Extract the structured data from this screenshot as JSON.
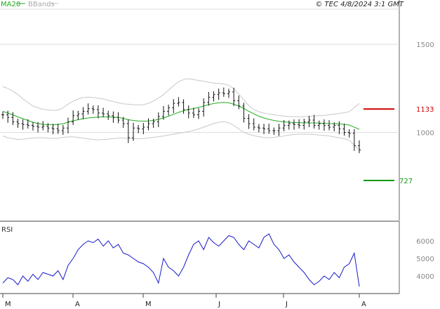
{
  "header": {
    "legend_ma": "MA20",
    "legend_bb": "BBands",
    "timestamp": "© TEC 4/8/2024 3:1 GMT"
  },
  "colors": {
    "ma": "#22aa22",
    "bbands": "#c8c8c8",
    "price": "#111111",
    "rsi": "#1a1acc",
    "resistance": "#cc0000",
    "support": "#119911",
    "grid": "#dddddd"
  },
  "chart_data": [
    {
      "type": "bar",
      "panel": "price",
      "yticks": [
        1500,
        1000
      ],
      "ytick_labels": [
        "1500",
        "1000"
      ],
      "levels": [
        {
          "label": "1133",
          "value": 1133,
          "role": "resistance"
        },
        {
          "label": "727",
          "value": 727,
          "role": "support"
        }
      ],
      "ylim": [
        500,
        1700
      ],
      "close": [
        1100,
        1085,
        1060,
        1050,
        1045,
        1040,
        1035,
        1030,
        1035,
        1025,
        1020,
        1010,
        1025,
        1060,
        1095,
        1105,
        1120,
        1135,
        1130,
        1110,
        1105,
        1095,
        1085,
        1070,
        1050,
        970,
        1025,
        1020,
        1030,
        1050,
        1060,
        1090,
        1120,
        1140,
        1165,
        1170,
        1130,
        1110,
        1100,
        1120,
        1170,
        1200,
        1215,
        1225,
        1220,
        1230,
        1180,
        1150,
        1080,
        1050,
        1030,
        1025,
        1020,
        1010,
        1010,
        1025,
        1040,
        1050,
        1045,
        1040,
        1060,
        1070,
        1040,
        1050,
        1040,
        1030,
        1040,
        1020,
        1000,
        995,
        925,
        900
      ],
      "ma20": [
        1120,
        1110,
        1100,
        1088,
        1078,
        1068,
        1058,
        1050,
        1046,
        1044,
        1043,
        1045,
        1050,
        1058,
        1066,
        1072,
        1078,
        1082,
        1085,
        1087,
        1088,
        1088,
        1087,
        1085,
        1080,
        1072,
        1068,
        1065,
        1064,
        1065,
        1068,
        1074,
        1082,
        1092,
        1103,
        1114,
        1123,
        1130,
        1136,
        1142,
        1150,
        1158,
        1164,
        1168,
        1170,
        1168,
        1160,
        1150,
        1136,
        1120,
        1105,
        1092,
        1082,
        1074,
        1068,
        1063,
        1060,
        1058,
        1056,
        1055,
        1054,
        1054,
        1054,
        1053,
        1052,
        1050,
        1049,
        1048,
        1046,
        1042,
        1030,
        1018
      ],
      "bb_upper": [
        1260,
        1250,
        1235,
        1215,
        1190,
        1170,
        1150,
        1140,
        1132,
        1128,
        1125,
        1127,
        1140,
        1160,
        1178,
        1190,
        1198,
        1200,
        1198,
        1195,
        1190,
        1182,
        1175,
        1168,
        1162,
        1160,
        1158,
        1156,
        1158,
        1165,
        1178,
        1195,
        1215,
        1240,
        1265,
        1288,
        1300,
        1305,
        1300,
        1295,
        1290,
        1285,
        1280,
        1278,
        1275,
        1268,
        1248,
        1218,
        1185,
        1152,
        1130,
        1118,
        1110,
        1104,
        1100,
        1096,
        1093,
        1090,
        1090,
        1088,
        1090,
        1092,
        1094,
        1095,
        1097,
        1100,
        1104,
        1108,
        1112,
        1118,
        1140,
        1165
      ],
      "bb_lower": [
        980,
        970,
        965,
        960,
        962,
        966,
        968,
        970,
        970,
        968,
        966,
        968,
        972,
        975,
        975,
        972,
        968,
        964,
        960,
        958,
        960,
        962,
        965,
        968,
        968,
        966,
        965,
        964,
        966,
        968,
        972,
        976,
        980,
        985,
        990,
        995,
        1000,
        1005,
        1012,
        1020,
        1030,
        1040,
        1050,
        1058,
        1060,
        1055,
        1040,
        1020,
        1000,
        990,
        982,
        976,
        972,
        970,
        972,
        976,
        980,
        985,
        988,
        990,
        990,
        990,
        988,
        985,
        983,
        980,
        975,
        970,
        965,
        955,
        930,
        900
      ]
    },
    {
      "type": "line",
      "panel": "rsi",
      "title": "RSI",
      "yticks": [
        60,
        50,
        40
      ],
      "ytick_labels": [
        "6000",
        "5000",
        "4000"
      ],
      "ylim": [
        30,
        70
      ],
      "values": [
        36,
        39,
        38,
        35,
        40,
        37,
        41,
        38,
        42,
        41,
        40,
        43,
        38,
        46,
        50,
        55,
        58,
        60,
        59,
        61,
        57,
        60,
        56,
        58,
        53,
        52,
        50,
        48,
        47,
        45,
        42,
        36,
        50,
        45,
        43,
        40,
        45,
        52,
        58,
        60,
        55,
        62,
        59,
        57,
        60,
        63,
        62,
        58,
        55,
        60,
        58,
        56,
        62,
        64,
        58,
        55,
        50,
        52,
        48,
        45,
        42,
        38,
        35,
        37,
        40,
        38,
        42,
        39,
        45,
        47,
        53,
        34
      ]
    }
  ],
  "months": [
    "M",
    "A",
    "M",
    "J",
    "J",
    "A"
  ]
}
